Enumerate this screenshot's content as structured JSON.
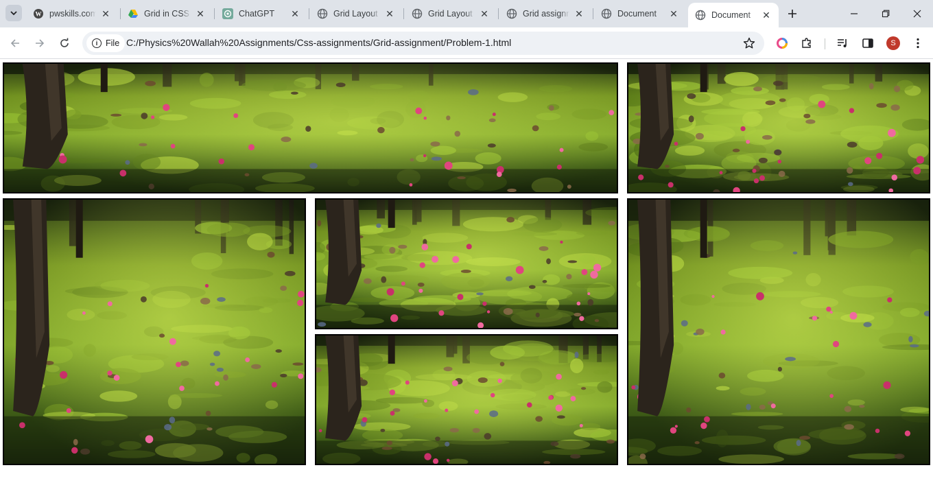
{
  "browser": {
    "tabs": [
      {
        "title": "pwskills.com",
        "favicon": "wordpress-icon",
        "active": false
      },
      {
        "title": "Grid in CSS / CSS Grid",
        "favicon": "google-drive-icon",
        "active": false
      },
      {
        "title": "ChatGPT",
        "favicon": "chatgpt-icon",
        "active": false
      },
      {
        "title": "Grid Layout in CSS",
        "favicon": "globe-icon",
        "active": false
      },
      {
        "title": "Grid Layout in CSS",
        "favicon": "globe-icon",
        "active": false
      },
      {
        "title": "Grid assignment",
        "favicon": "globe-icon",
        "active": false
      },
      {
        "title": "Document",
        "favicon": "globe-icon",
        "active": false
      },
      {
        "title": "Document",
        "favicon": "globe-icon",
        "active": true
      }
    ],
    "site_chip": "File",
    "url": "C:/Physics%20Wallah%20Assignments/Css-assignments/Grid-assignment/Problem-1.html",
    "profile_initial": "S"
  },
  "page": {
    "grid_items": [
      {
        "name": "image-1",
        "alt": "forest moss floor with fallen flowers"
      },
      {
        "name": "image-2",
        "alt": "forest moss floor with fallen flowers"
      },
      {
        "name": "image-3",
        "alt": "forest moss floor with fallen flowers"
      },
      {
        "name": "image-4",
        "alt": "forest moss floor with fallen flowers"
      },
      {
        "name": "image-5",
        "alt": "forest moss floor with fallen flowers"
      },
      {
        "name": "image-6",
        "alt": "forest moss floor with fallen flowers"
      }
    ]
  },
  "colors": {
    "tabstrip_bg": "#dfe3e9",
    "omnibox_bg": "#eef1f5",
    "image_border": "#000000",
    "avatar_bg": "#c0392b"
  }
}
